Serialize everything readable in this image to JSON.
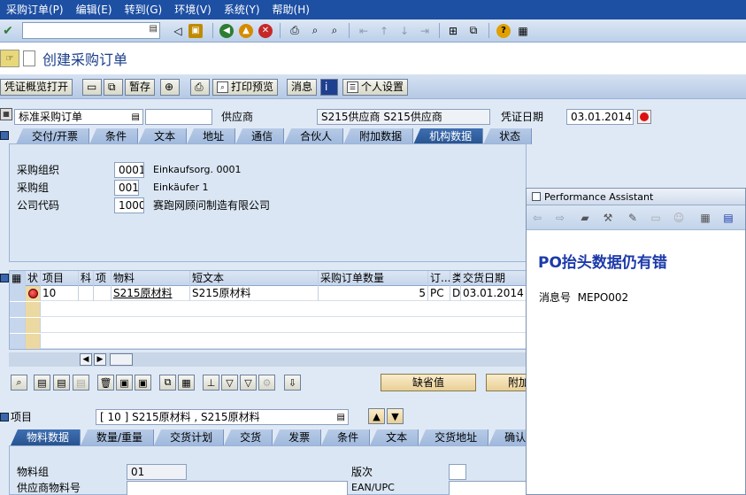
{
  "menu": [
    "采购订单(P)",
    "编辑(E)",
    "转到(G)",
    "环境(V)",
    "系统(Y)",
    "帮助(H)"
  ],
  "std_toolbar": {
    "command_value": "",
    "icons": [
      "enter-icon",
      "back-icon",
      "exit-icon",
      "cancel-icon",
      "print-icon",
      "find-icon",
      "find-next-icon",
      "first-page-icon",
      "prev-page-icon",
      "next-page-icon",
      "last-page-icon",
      "new-session-icon",
      "shortcut-icon",
      "help-icon",
      "layout-icon"
    ]
  },
  "title": "创建采购订单",
  "app_toolbar": {
    "doc_overview": "凭证概览打开",
    "hold": "暂存",
    "print_preview": "打印预览",
    "messages": "消息",
    "personal_settings": "个人设置"
  },
  "header": {
    "doc_type": "标准采购订单",
    "vendor_label": "供应商",
    "vendor_value": "S215供应商 S215供应商",
    "doc_date_label": "凭证日期",
    "doc_date_value": "03.01.2014"
  },
  "header_tabs": [
    "交付/开票",
    "条件",
    "文本",
    "地址",
    "通信",
    "合伙人",
    "附加数据",
    "机构数据",
    "状态"
  ],
  "header_active_tab": 7,
  "org_data": [
    {
      "label": "采购组织",
      "code": "0001",
      "desc": "Einkaufsorg. 0001"
    },
    {
      "label": "采购组",
      "code": "001",
      "desc": "Einkäufer 1"
    },
    {
      "label": "公司代码",
      "code": "1000",
      "desc": "赛跑网顾问制造有限公司"
    }
  ],
  "items_table": {
    "columns": [
      "状",
      "项目",
      "科",
      "项",
      "物料",
      "短文本",
      "采购订单数量",
      "订...",
      "类",
      "交货日期"
    ],
    "rows": [
      {
        "item": "10",
        "material": "S215原材料",
        "short_text": "S215原材料",
        "qty": "5",
        "unit": "PC",
        "cat": "D",
        "date": "03.01.2014"
      }
    ]
  },
  "table_tools": {
    "default_btn": "缺省值",
    "more_btn": "附加"
  },
  "item_detail": {
    "label": "项目",
    "value": "[ 10 ] S215原材料 , S215原材料"
  },
  "item_tabs": [
    "物料数据",
    "数量/重量",
    "交货计划",
    "交货",
    "发票",
    "条件",
    "文本",
    "交货地址",
    "确认"
  ],
  "item_active_tab": 0,
  "material_fields": {
    "matl_group_label": "物料组",
    "matl_group_value": "01",
    "vendor_mat_label": "供应商物料号",
    "revision_label": "版次",
    "ean_label": "EAN/UPC"
  },
  "perf_assistant": {
    "title": "Performance Assistant",
    "heading": "PO抬头数据仍有错",
    "msg_label": "消息号",
    "msg_no": "MEPO002"
  }
}
